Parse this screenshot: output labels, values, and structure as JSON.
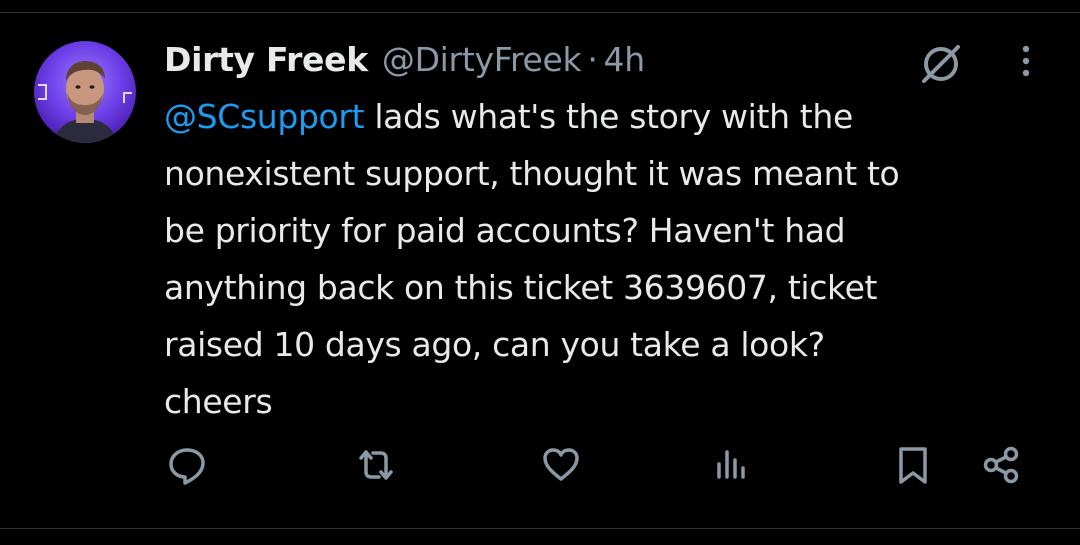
{
  "tweet": {
    "author": {
      "display_name": "Dirty Freek",
      "handle": "@DirtyFreek",
      "avatar_icon": "profile-photo"
    },
    "separator": "·",
    "time": "4h",
    "mention": "@SCsupport",
    "text_lines": [
      " lads what's the story with the",
      "nonexistent support, thought it was meant to",
      "be priority for paid accounts? Haven't had",
      "anything back on this ticket 3639607, ticket",
      "raised 10 days ago, can you take a look?",
      "cheers"
    ]
  },
  "header_icons": [
    "grok-icon",
    "more-options-icon"
  ],
  "actions": [
    "reply-icon",
    "retweet-icon",
    "like-icon",
    "views-icon",
    "bookmark-icon",
    "share-icon"
  ],
  "colors": {
    "background": "#000000",
    "text": "#e7e9ea",
    "secondary": "#8b98a5",
    "link": "#1d9bf0",
    "divider": "#2f3336"
  }
}
